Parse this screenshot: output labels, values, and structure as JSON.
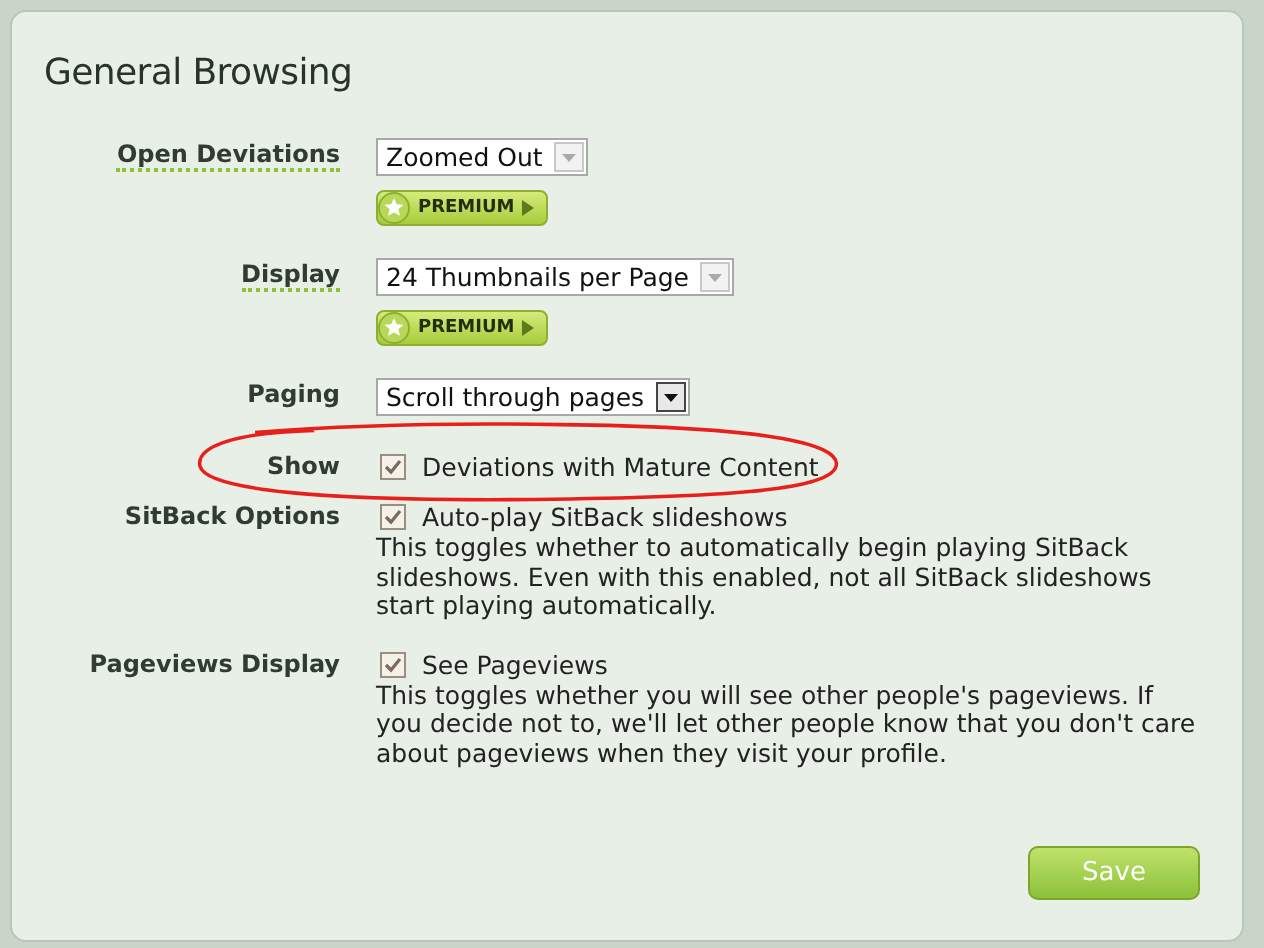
{
  "panel": {
    "title": "General Browsing"
  },
  "rows": [
    {
      "kind": "select",
      "label": "Open Deviations",
      "has_tip": true,
      "value": "Zoomed Out",
      "disabled": true,
      "badge": "PREMIUM"
    },
    {
      "kind": "select",
      "label": "Display",
      "has_tip": true,
      "value": "24 Thumbnails per Page",
      "disabled": true,
      "badge": "PREMIUM"
    },
    {
      "kind": "select",
      "label": "Paging",
      "has_tip": false,
      "value": "Scroll through pages",
      "disabled": false
    },
    {
      "kind": "checkbox",
      "label": "Show",
      "has_tip": false,
      "option": "Deviations with Mature Content",
      "checked": true,
      "circled": true
    },
    {
      "kind": "checkbox",
      "label": "SitBack Options",
      "has_tip": false,
      "option": "Auto-play SitBack slideshows",
      "checked": true,
      "circled": false,
      "help": "This toggles whether to automatically begin playing SitBack slideshows. Even with this enabled, not all SitBack slideshows start playing automatically."
    },
    {
      "kind": "checkbox",
      "label": "Pageviews Display",
      "has_tip": false,
      "option": "See Pageviews",
      "checked": true,
      "circled": false,
      "help": "This toggles whether you will see other people's pageviews. If you decide not to, we'll let other people know that you don't care about pageviews when they visit your profile."
    }
  ],
  "save_button": "Save"
}
